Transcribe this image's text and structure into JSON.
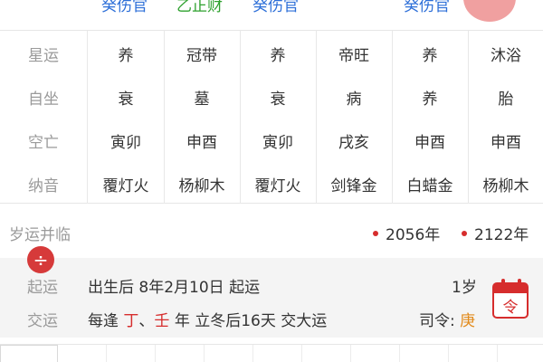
{
  "top_row": [
    {
      "text": "癸伤官",
      "color": "blue"
    },
    {
      "text": "乙正财",
      "color": "green"
    },
    {
      "text": "癸伤官",
      "color": "blue"
    },
    {
      "text": "癸伤官",
      "color": "blue"
    }
  ],
  "grid": {
    "rows": [
      {
        "label": "星运",
        "cells": [
          "养",
          "冠带",
          "养",
          "帝旺",
          "养",
          "沐浴"
        ]
      },
      {
        "label": "自坐",
        "cells": [
          "衰",
          "墓",
          "衰",
          "病",
          "养",
          "胎"
        ]
      },
      {
        "label": "空亡",
        "cells": [
          "寅卯",
          "申酉",
          "寅卯",
          "戌亥",
          "申酉",
          "申酉"
        ]
      },
      {
        "label": "纳音",
        "cells": [
          "覆灯火",
          "杨柳木",
          "覆灯火",
          "剑锋金",
          "白蜡金",
          "杨柳木"
        ]
      }
    ]
  },
  "suiyun": {
    "label": "岁运并临",
    "years": [
      "2056年",
      "2122年"
    ]
  },
  "qiyun": {
    "label": "起运",
    "text": "出生后 8年2月10日 起运",
    "age": "1岁"
  },
  "jiaoyun": {
    "label": "交运",
    "prefix": "每逢",
    "stem1": "丁",
    "sep": "、",
    "stem2": "壬",
    "suffix": "年 立冬后16天 交大运",
    "siling_label": "司令:",
    "siling_value": "庚"
  },
  "badge_symbol": "÷",
  "calendar_label": "令",
  "colors": {
    "accent_red": "#d62d2d",
    "blue": "#2d6fd8",
    "green": "#2fa12f",
    "orange": "#e28a1a",
    "label_gray": "#9a9a9a"
  },
  "icons": [
    "fab-button",
    "plus-minus-badge-icon",
    "calendar-ling-icon",
    "red-dot-icon"
  ]
}
